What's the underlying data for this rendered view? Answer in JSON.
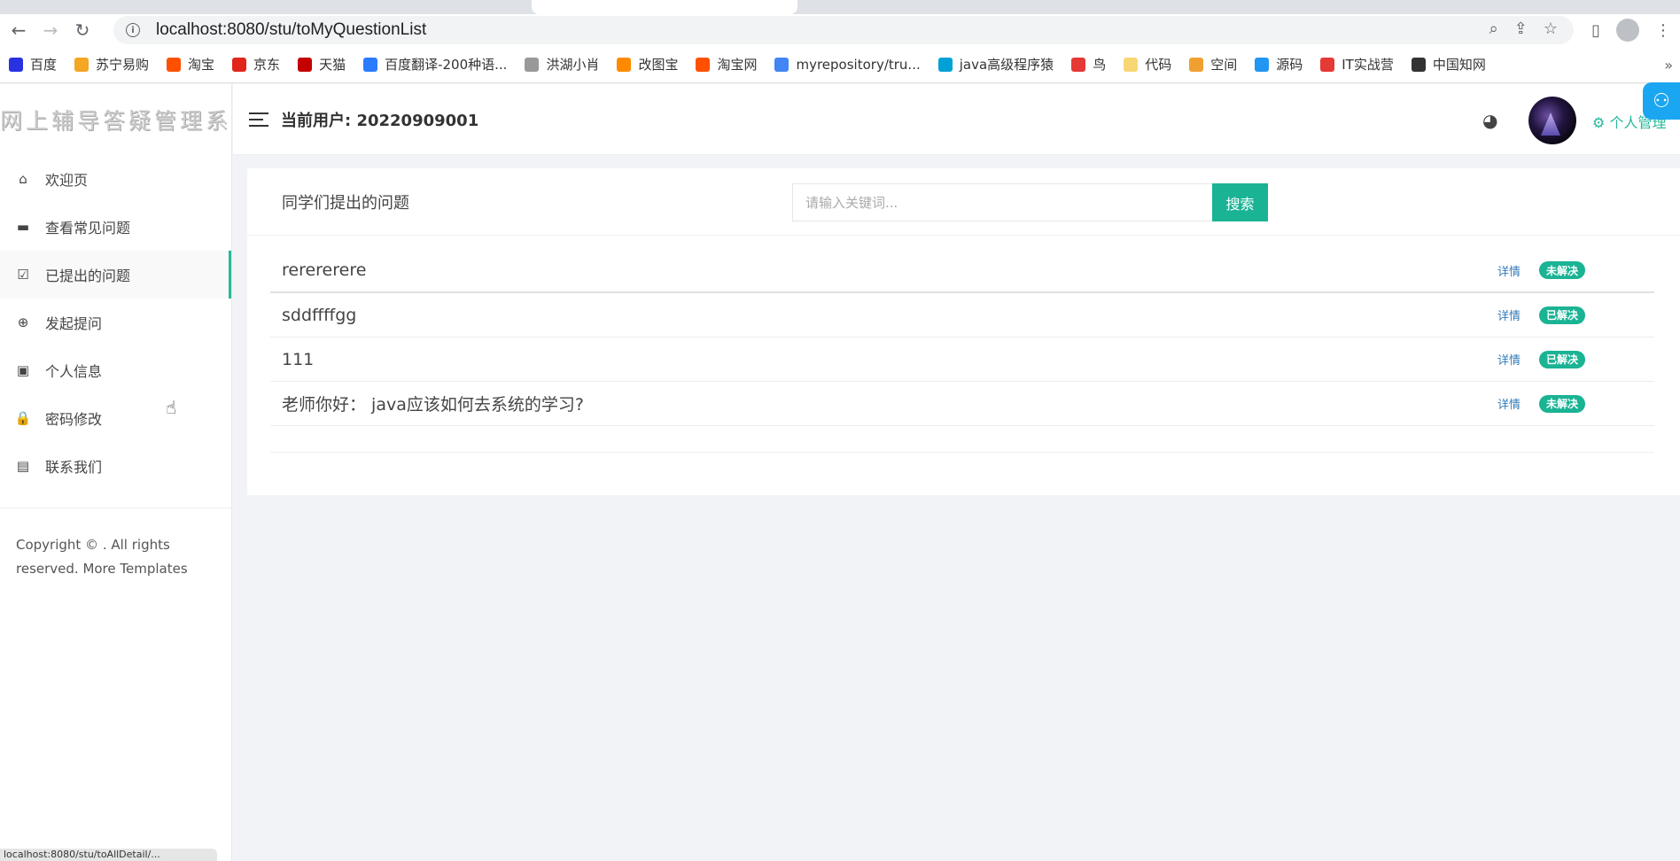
{
  "browser": {
    "url": "localhost:8080/stu/toMyQuestionList",
    "bookmarks": [
      {
        "label": "百度",
        "color": "#2932e1"
      },
      {
        "label": "苏宁易购",
        "color": "#f5a623"
      },
      {
        "label": "淘宝",
        "color": "#ff5000"
      },
      {
        "label": "京东",
        "color": "#e1251b"
      },
      {
        "label": "天猫",
        "color": "#c40000"
      },
      {
        "label": "百度翻译-200种语...",
        "color": "#2b7bff"
      },
      {
        "label": "洪湖小肖",
        "color": "#999999"
      },
      {
        "label": "改图宝",
        "color": "#ff8a00"
      },
      {
        "label": "淘宝网",
        "color": "#ff5000"
      },
      {
        "label": "myrepository/tru...",
        "color": "#4285f4"
      },
      {
        "label": "java高级程序猿",
        "color": "#00a1d6"
      },
      {
        "label": "鸟",
        "color": "#e53935"
      },
      {
        "label": "代码",
        "color": "#f7d774"
      },
      {
        "label": "空间",
        "color": "#f0a030"
      },
      {
        "label": "源码",
        "color": "#2196f3"
      },
      {
        "label": "IT实战营",
        "color": "#e53935"
      },
      {
        "label": "中国知网",
        "color": "#333333"
      }
    ],
    "status_text": "localhost:8080/stu/toAllDetail/..."
  },
  "app": {
    "logo_text": "网上辅导答疑管理系统",
    "current_user_label": "当前用户: 20220909001",
    "personal_manage": "个人管理",
    "menu": [
      {
        "label": "欢迎页",
        "icon": "home-icon",
        "glyph": "⌂"
      },
      {
        "label": "查看常见问题",
        "icon": "comment-icon",
        "glyph": "▬"
      },
      {
        "label": "已提出的问题",
        "icon": "check-square-icon",
        "glyph": "☑",
        "active": true
      },
      {
        "label": "发起提问",
        "icon": "plus-circle-icon",
        "glyph": "⊕"
      },
      {
        "label": "个人信息",
        "icon": "user-card-icon",
        "glyph": "▣"
      },
      {
        "label": "密码修改",
        "icon": "lock-icon",
        "glyph": "🔒"
      },
      {
        "label": "联系我们",
        "icon": "contacts-icon",
        "glyph": "▤"
      }
    ],
    "copyright": "Copyright © . All rights reserved. More Templates"
  },
  "main": {
    "title": "同学们提出的问题",
    "search_placeholder": "请输入关键词...",
    "search_button": "搜索",
    "detail_label": "详情",
    "questions": [
      {
        "text": "rerererere",
        "status": "未解决"
      },
      {
        "text": "sddffffgg",
        "status": "已解决"
      },
      {
        "text": "111",
        "status": "已解决"
      },
      {
        "text": "老师你好： java应该如何去系统的学习?",
        "status": "未解决"
      }
    ]
  },
  "colors": {
    "accent": "#1ab394",
    "link": "#337ab7",
    "active_bar": "#26b89a"
  }
}
